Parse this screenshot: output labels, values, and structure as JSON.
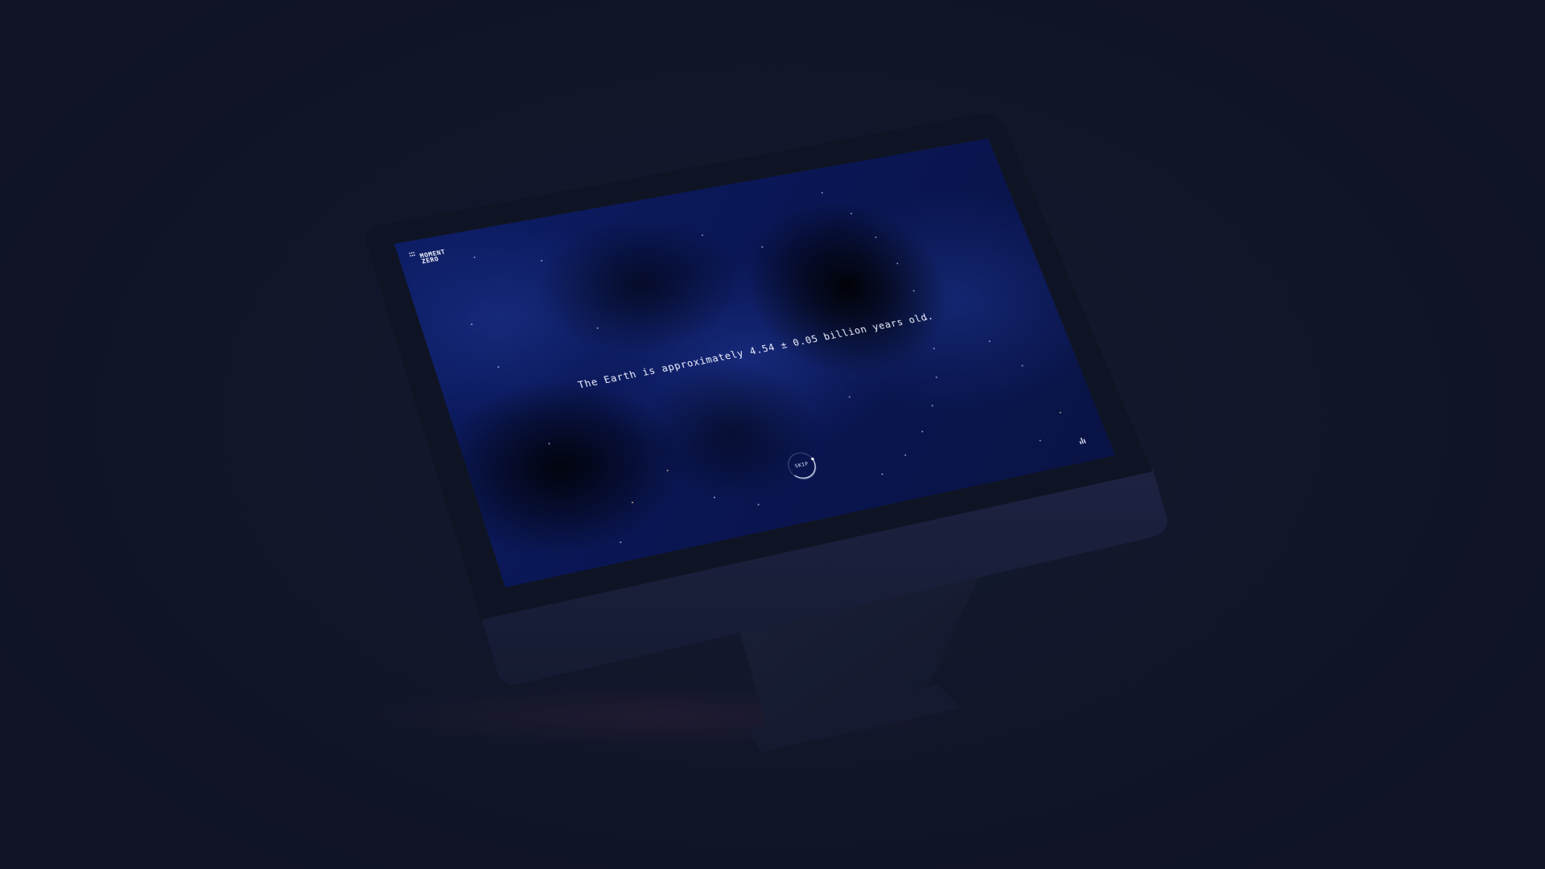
{
  "app": {
    "logo_line1": "MOMENT",
    "logo_line2": "ZERO"
  },
  "intro": {
    "headline": "The Earth is approximately 4.54 ± 0.05 billion years old."
  },
  "controls": {
    "skip_label": "SKIP",
    "sound_icon": "sound-bars-icon"
  },
  "colors": {
    "background": "#10152a",
    "screen_deep_blue": "#0a1654",
    "text": "#eef1ff"
  }
}
